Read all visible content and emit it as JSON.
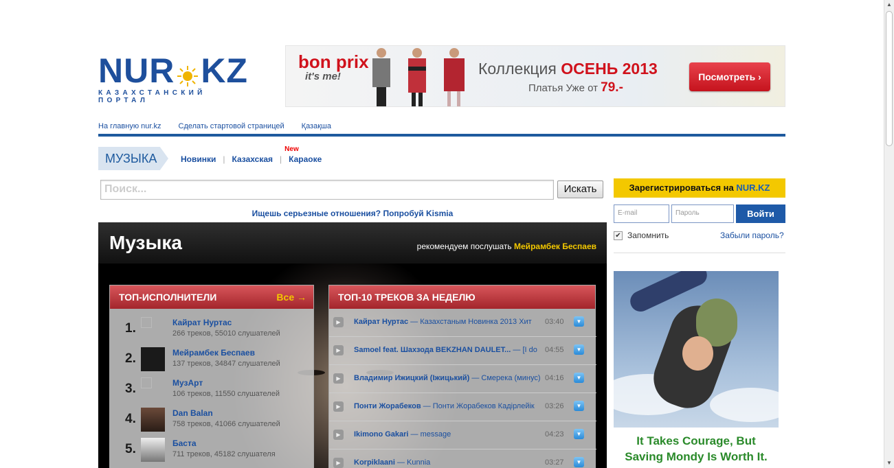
{
  "logo": {
    "left": "NUR",
    "right": "KZ",
    "tagline": "КАЗАХСТАНСКИЙ ПОРТАЛ"
  },
  "banner": {
    "brand_top": "bon prix",
    "brand_bottom": "it's me!",
    "collection_prefix": "Коллекция ",
    "collection_highlight": "ОСЕНЬ 2013",
    "price_prefix": "Платья Уже от ",
    "price_value": "79.-",
    "button": "Посмотреть ›"
  },
  "toplinks": [
    "На главную nur.kz",
    "Сделать стартовой страницей",
    "Қазақша"
  ],
  "section": {
    "tag": "МУЗЫКА",
    "nav": [
      "Новинки",
      "Казахская",
      "Караоке"
    ],
    "new_badge": "New"
  },
  "search": {
    "placeholder": "Поиск...",
    "button": "Искать"
  },
  "kismia": "Ищешь серьезные отношения? Попробуй Kismia",
  "music": {
    "title": "Музыка",
    "recommend_prefix": "рекомендуем послушать ",
    "recommend_artist": "Мейрамбек Беспаев",
    "artists_header": "ТОП-ИСПОЛНИТЕЛИ",
    "artists_all": "Все →",
    "artists": [
      {
        "num": "1.",
        "name": "Кайрат Нуртас",
        "meta": "266 треков, 55010 слушателей",
        "has_photo": false
      },
      {
        "num": "2.",
        "name": "Мейрамбек Беспаев",
        "meta": "137 треков, 34847 слушателей",
        "has_photo": true
      },
      {
        "num": "3.",
        "name": "МузАрт",
        "meta": "106 треков, 11550 слушателей",
        "has_photo": false
      },
      {
        "num": "4.",
        "name": "Dan Balan",
        "meta": "758 треков, 41066 слушателей",
        "has_photo": true
      },
      {
        "num": "5.",
        "name": "Баста",
        "meta": "711 треков, 45182 слушателя",
        "has_photo": true
      }
    ],
    "tracks_header": "ТОП-10 ТРЕКОВ ЗА НЕДЕЛЮ",
    "tracks": [
      {
        "artist": "Кайрат Нуртас",
        "song": " — Казахстаным Новинка 2013 Хит",
        "duration": "03:40"
      },
      {
        "artist": "Samoel feat. Шахзода BEKZHAN DAULET...",
        "song": " — [I do",
        "duration": "04:55"
      },
      {
        "artist": "Владимир Ижицкий (Іжицький)",
        "song": " — Смерека (минус)",
        "duration": "04:16"
      },
      {
        "artist": "Понти Жорабеков",
        "song": " — Понти Жорабеков Кадірлейік",
        "duration": "03:26"
      },
      {
        "artist": "Ikimono Gakari",
        "song": " — message",
        "duration": "04:23"
      },
      {
        "artist": "Korpiklaani",
        "song": " — Kunnia",
        "duration": "03:27"
      }
    ]
  },
  "auth": {
    "register_prefix": "Зарегистрироваться на ",
    "register_brand": "NUR.KZ",
    "email_placeholder": "E-mail",
    "password_placeholder": "Пароль",
    "login_button": "Войти",
    "remember": "Запомнить",
    "remember_checked": true,
    "forgot": "Забыли пароль?"
  },
  "ad": {
    "line1": "It Takes Courage, But",
    "line2": "Saving Mondy Is Worth It."
  },
  "colors": {
    "brand_blue": "#1e4f9c",
    "accent_red": "#d0121c",
    "accent_yellow": "#f3c800"
  }
}
